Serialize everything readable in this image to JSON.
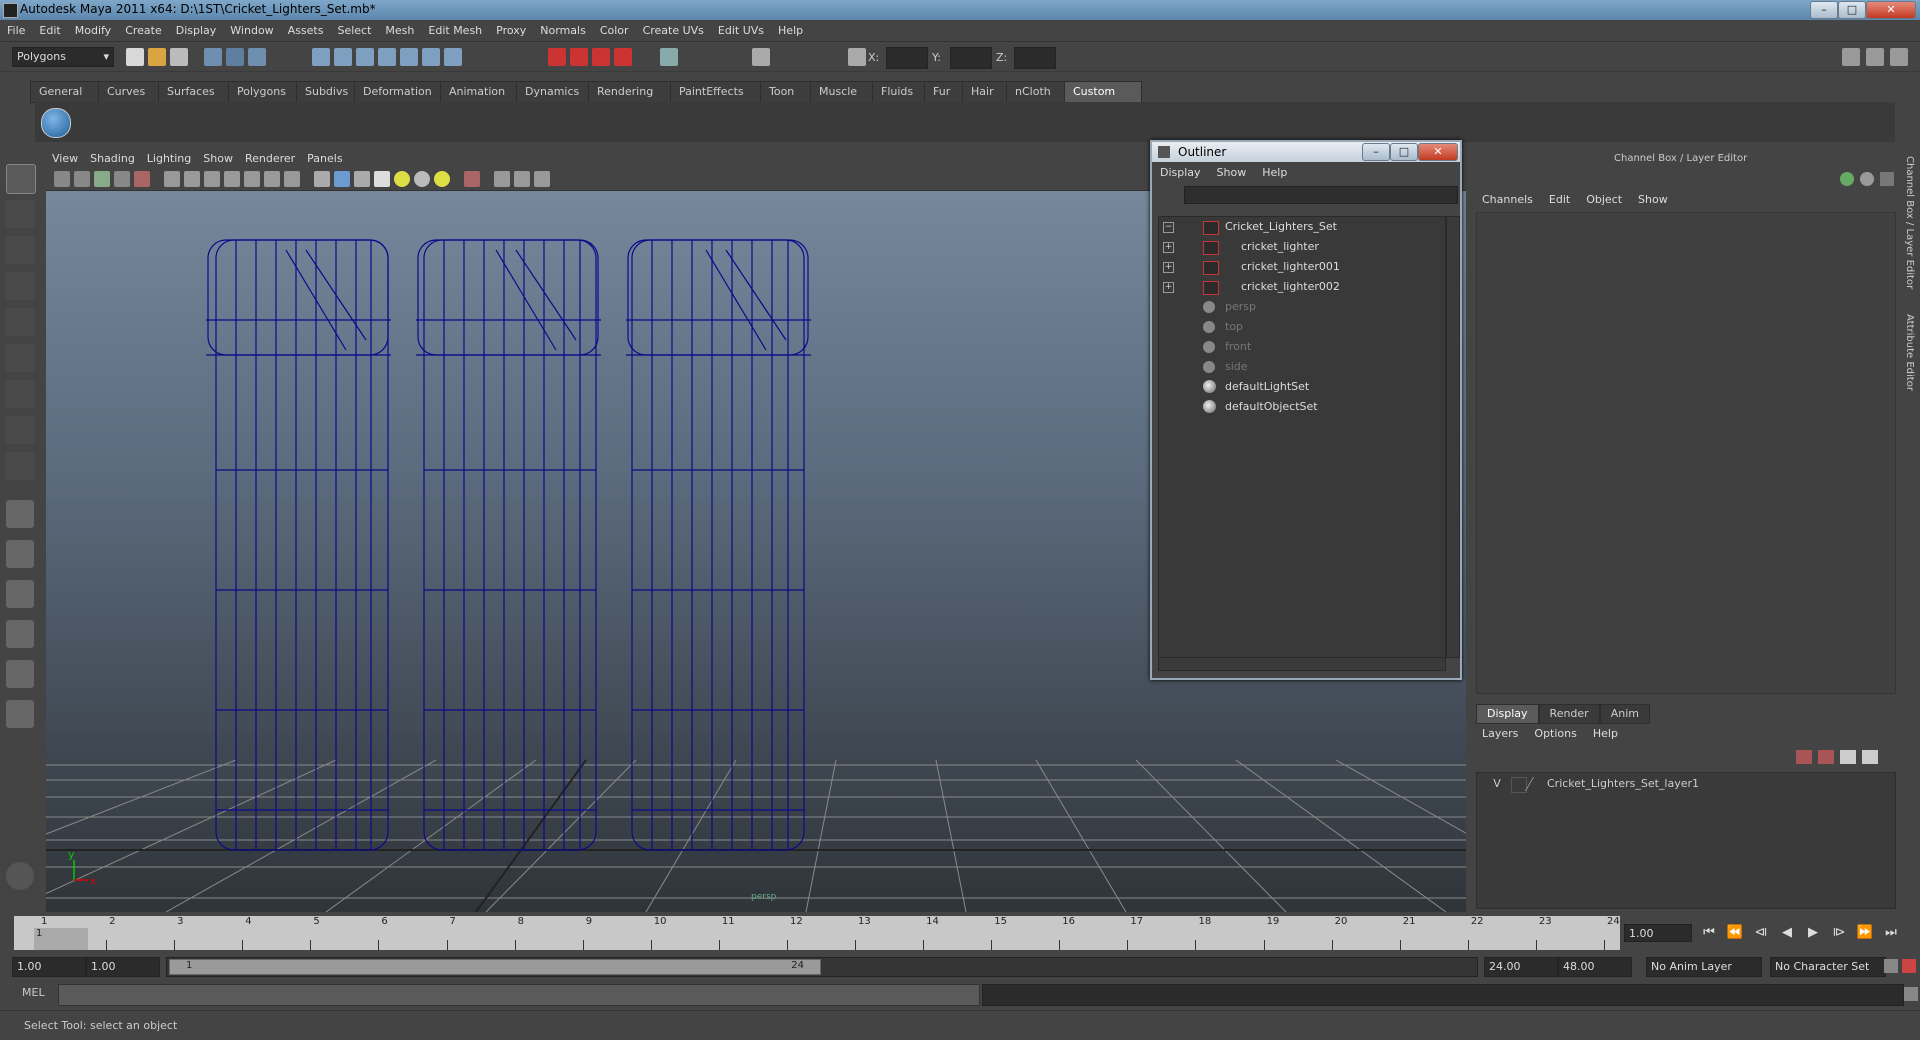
{
  "window": {
    "title": "Autodesk Maya 2011 x64: D:\\1ST\\Cricket_Lighters_Set.mb*",
    "minimize": "–",
    "maximize": "□",
    "close": "✕"
  },
  "menubar": [
    "File",
    "Edit",
    "Modify",
    "Create",
    "Display",
    "Window",
    "Assets",
    "Select",
    "Mesh",
    "Edit Mesh",
    "Proxy",
    "Normals",
    "Color",
    "Create UVs",
    "Edit UVs",
    "Help"
  ],
  "statusline": {
    "menuset": "Polygons",
    "x_label": "X:",
    "y_label": "Y:",
    "z_label": "Z:"
  },
  "shelf": {
    "tabs": [
      "General",
      "Curves",
      "Surfaces",
      "Polygons",
      "Subdivs",
      "Deformation",
      "Animation",
      "Dynamics",
      "Rendering",
      "PaintEffects",
      "Toon",
      "Muscle",
      "Fluids",
      "Fur",
      "Hair",
      "nCloth",
      "Custom"
    ],
    "active": "Custom"
  },
  "viewport": {
    "menu": [
      "View",
      "Shading",
      "Lighting",
      "Show",
      "Renderer",
      "Panels"
    ],
    "camera": "persp",
    "axis_y": "y",
    "axis_x": "x"
  },
  "outliner": {
    "title": "Outliner",
    "menu": [
      "Display",
      "Show",
      "Help"
    ],
    "items": [
      {
        "label": "Cricket_Lighters_Set",
        "type": "mesh",
        "expander": "−",
        "level": 0,
        "dim": false
      },
      {
        "label": "cricket_lighter",
        "type": "mesh",
        "expander": "+",
        "level": 1,
        "dim": false
      },
      {
        "label": "cricket_lighter001",
        "type": "mesh",
        "expander": "+",
        "level": 1,
        "dim": false
      },
      {
        "label": "cricket_lighter002",
        "type": "mesh",
        "expander": "+",
        "level": 1,
        "dim": false
      },
      {
        "label": "persp",
        "type": "camera",
        "expander": "",
        "level": 0,
        "dim": true
      },
      {
        "label": "top",
        "type": "camera",
        "expander": "",
        "level": 0,
        "dim": true
      },
      {
        "label": "front",
        "type": "camera",
        "expander": "",
        "level": 0,
        "dim": true
      },
      {
        "label": "side",
        "type": "camera",
        "expander": "",
        "level": 0,
        "dim": true
      },
      {
        "label": "defaultLightSet",
        "type": "set",
        "expander": "",
        "level": 0,
        "dim": false
      },
      {
        "label": "defaultObjectSet",
        "type": "set",
        "expander": "",
        "level": 0,
        "dim": false
      }
    ]
  },
  "channelbox": {
    "title": "Channel Box / Layer Editor",
    "menu": [
      "Channels",
      "Edit",
      "Object",
      "Show"
    ],
    "layer_tabs": [
      "Display",
      "Render",
      "Anim"
    ],
    "active_layer_tab": "Display",
    "layer_menu": [
      "Layers",
      "Options",
      "Help"
    ],
    "layer": {
      "visibility": "V",
      "name": "Cricket_Lighters_Set_layer1"
    },
    "side_tabs": [
      "Channel Box / Layer Editor",
      "Attribute Editor"
    ]
  },
  "timeslider": {
    "frames": [
      "1",
      "2",
      "3",
      "4",
      "5",
      "6",
      "7",
      "8",
      "9",
      "10",
      "11",
      "12",
      "13",
      "14",
      "15",
      "16",
      "17",
      "18",
      "19",
      "20",
      "21",
      "22",
      "23",
      "24"
    ],
    "current_frame": "1.00",
    "current_marker": "1"
  },
  "playback": [
    "⏮",
    "⏪",
    "⧏",
    "◀",
    "▶",
    "⧐",
    "⏩",
    "⏭"
  ],
  "range": {
    "start": "1.00",
    "playback_start": "1.00",
    "thumb_start": "1",
    "thumb_end": "24",
    "playback_end": "24.00",
    "end": "48.00",
    "anim_layer": "No Anim Layer",
    "character_set": "No Character Set"
  },
  "cmdline": {
    "label": "MEL"
  },
  "helpline": {
    "text": "Select Tool: select an object"
  },
  "colors": {
    "wire": "#0a0a8a",
    "grid": "#8a8a8a",
    "bg": "#444444"
  }
}
